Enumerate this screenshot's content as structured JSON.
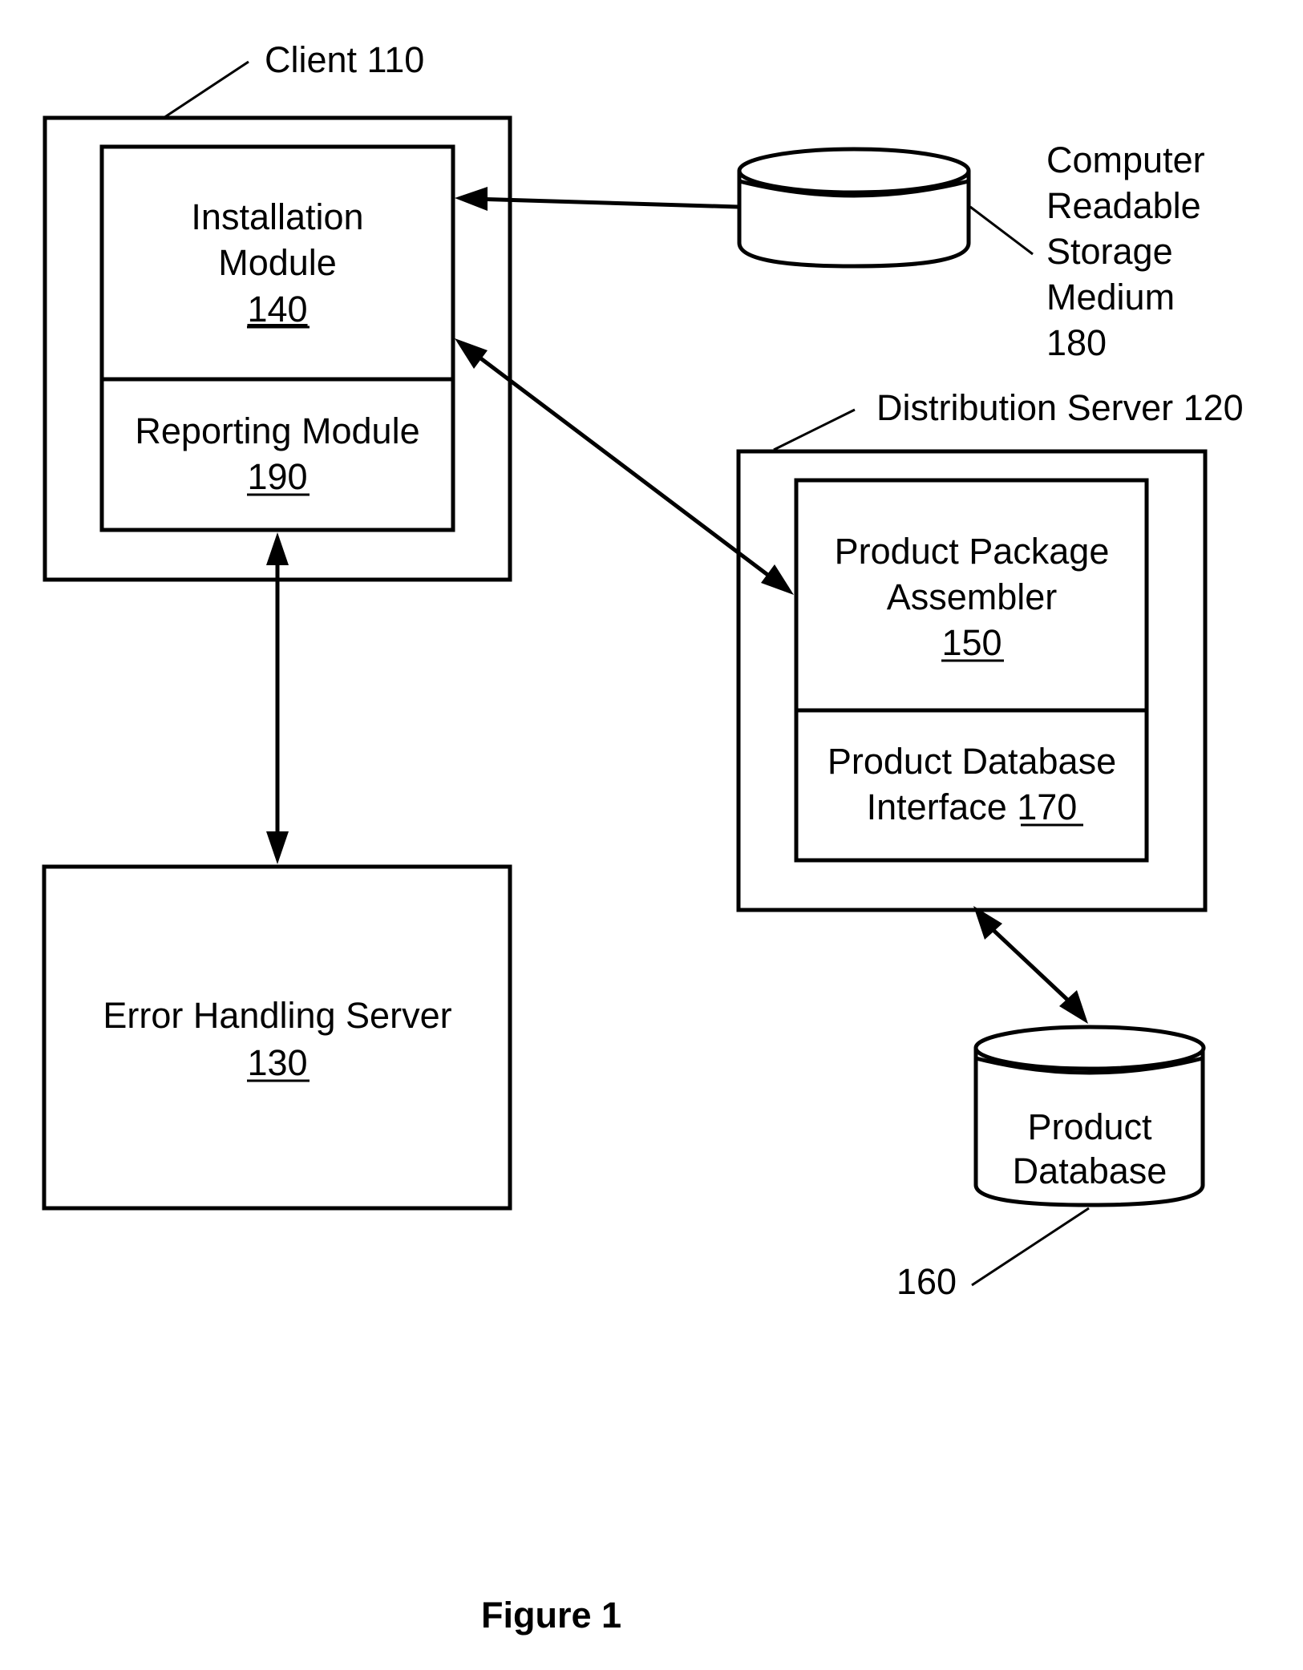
{
  "figure": {
    "caption": "Figure 1",
    "nodes": {
      "client": {
        "label": "Client 110"
      },
      "installation_module": {
        "lines": [
          "Installation",
          "Module"
        ],
        "ref": "140"
      },
      "reporting_module": {
        "lines": [
          "Reporting Module"
        ],
        "ref": "190"
      },
      "error_handling_server": {
        "lines": [
          "Error Handling Server"
        ],
        "ref": "130"
      },
      "storage_medium": {
        "lines": [
          "Computer",
          "Readable",
          "Storage",
          "Medium",
          "180"
        ]
      },
      "distribution_server": {
        "label": "Distribution Server 120"
      },
      "product_package_assembler": {
        "lines": [
          "Product Package",
          "Assembler"
        ],
        "ref": "150"
      },
      "product_database_interface": {
        "line1": "Product Database",
        "line2_prefix": "Interface ",
        "ref": "170"
      },
      "product_database": {
        "lines": [
          "Product",
          "Database"
        ],
        "ref_label": "160"
      }
    },
    "edges": [
      {
        "from": "storage_medium",
        "to": "installation_module",
        "direction": "to"
      },
      {
        "from": "installation_module",
        "to": "product_package_assembler",
        "direction": "both"
      },
      {
        "from": "reporting_module",
        "to": "error_handling_server",
        "direction": "both"
      },
      {
        "from": "product_database_interface",
        "to": "product_database",
        "direction": "both"
      }
    ]
  }
}
